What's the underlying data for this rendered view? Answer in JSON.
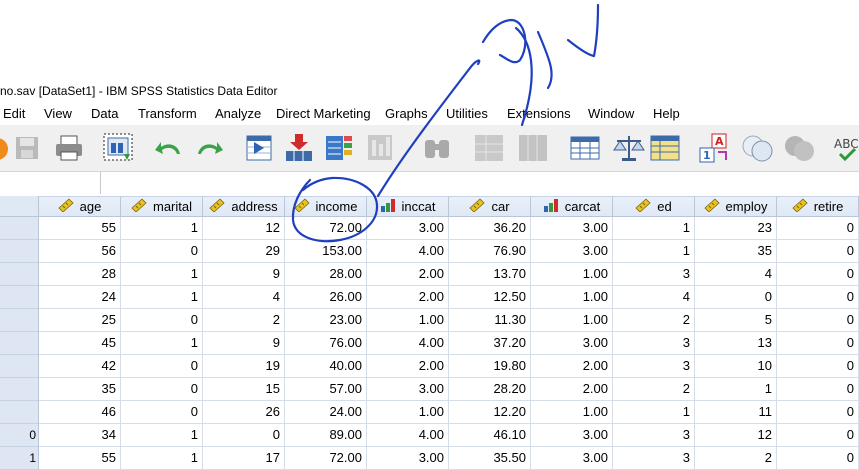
{
  "window": {
    "title": "no.sav [DataSet1] - IBM SPSS Statistics Data Editor"
  },
  "menu": [
    "Edit",
    "View",
    "Data",
    "Transform",
    "Analyze",
    "Direct Marketing",
    "Graphs",
    "Utilities",
    "Extensions",
    "Window",
    "Help"
  ],
  "toolbar": [
    {
      "icon": "open-icon",
      "disabled": false
    },
    {
      "icon": "save-icon",
      "disabled": true
    },
    {
      "icon": "print-icon",
      "disabled": false
    },
    {
      "icon": "recall-dialog-icon",
      "disabled": false
    },
    {
      "icon": "undo-icon",
      "disabled": false
    },
    {
      "icon": "redo-icon",
      "disabled": false
    },
    {
      "icon": "go-to-case-icon",
      "disabled": false
    },
    {
      "icon": "go-to-variable-icon",
      "disabled": false
    },
    {
      "icon": "variables-icon",
      "disabled": false
    },
    {
      "icon": "run-descriptive-icon",
      "disabled": true
    },
    {
      "icon": "find-icon",
      "disabled": true
    },
    {
      "icon": "insert-cases-icon",
      "disabled": true
    },
    {
      "icon": "insert-variable-icon",
      "disabled": true
    },
    {
      "icon": "split-file-icon",
      "disabled": false
    },
    {
      "icon": "weight-cases-icon",
      "disabled": false
    },
    {
      "icon": "select-cases-icon",
      "disabled": false
    },
    {
      "icon": "value-labels-icon",
      "disabled": false
    },
    {
      "icon": "use-sets-icon",
      "disabled": false
    },
    {
      "icon": "show-all-variables-icon",
      "disabled": true
    },
    {
      "icon": "spell-check-icon",
      "disabled": false
    }
  ],
  "columns": [
    {
      "name": "age",
      "icon": "scale-icon"
    },
    {
      "name": "marital",
      "icon": "scale-icon"
    },
    {
      "name": "address",
      "icon": "scale-icon"
    },
    {
      "name": "income",
      "icon": "scale-icon"
    },
    {
      "name": "inccat",
      "icon": "ordinal-icon"
    },
    {
      "name": "car",
      "icon": "scale-icon"
    },
    {
      "name": "carcat",
      "icon": "ordinal-icon"
    },
    {
      "name": "ed",
      "icon": "scale-icon"
    },
    {
      "name": "employ",
      "icon": "scale-icon"
    },
    {
      "name": "retire",
      "icon": "scale-icon"
    }
  ],
  "row_labels": [
    "",
    "",
    "",
    "",
    "",
    "",
    "",
    "",
    "",
    "0",
    "1"
  ],
  "rows": [
    [
      "55",
      "1",
      "12",
      "72.00",
      "3.00",
      "36.20",
      "3.00",
      "1",
      "23",
      "0"
    ],
    [
      "56",
      "0",
      "29",
      "153.00",
      "4.00",
      "76.90",
      "3.00",
      "1",
      "35",
      "0"
    ],
    [
      "28",
      "1",
      "9",
      "28.00",
      "2.00",
      "13.70",
      "1.00",
      "3",
      "4",
      "0"
    ],
    [
      "24",
      "1",
      "4",
      "26.00",
      "2.00",
      "12.50",
      "1.00",
      "4",
      "0",
      "0"
    ],
    [
      "25",
      "0",
      "2",
      "23.00",
      "1.00",
      "11.30",
      "1.00",
      "2",
      "5",
      "0"
    ],
    [
      "45",
      "1",
      "9",
      "76.00",
      "4.00",
      "37.20",
      "3.00",
      "3",
      "13",
      "0"
    ],
    [
      "42",
      "0",
      "19",
      "40.00",
      "2.00",
      "19.80",
      "2.00",
      "3",
      "10",
      "0"
    ],
    [
      "35",
      "0",
      "15",
      "57.00",
      "3.00",
      "28.20",
      "2.00",
      "2",
      "1",
      "0"
    ],
    [
      "46",
      "0",
      "26",
      "24.00",
      "1.00",
      "12.20",
      "1.00",
      "1",
      "11",
      "0"
    ],
    [
      "34",
      "1",
      "0",
      "89.00",
      "4.00",
      "46.10",
      "3.00",
      "3",
      "12",
      "0"
    ],
    [
      "55",
      "1",
      "17",
      "72.00",
      "3.00",
      "35.50",
      "3.00",
      "3",
      "2",
      "0"
    ]
  ],
  "colors": {
    "header_bg": "#dfe8f5",
    "grid_line": "#d5dde8",
    "ink": "#1f3fbf",
    "ruler_yellow": "#e8c21f"
  }
}
